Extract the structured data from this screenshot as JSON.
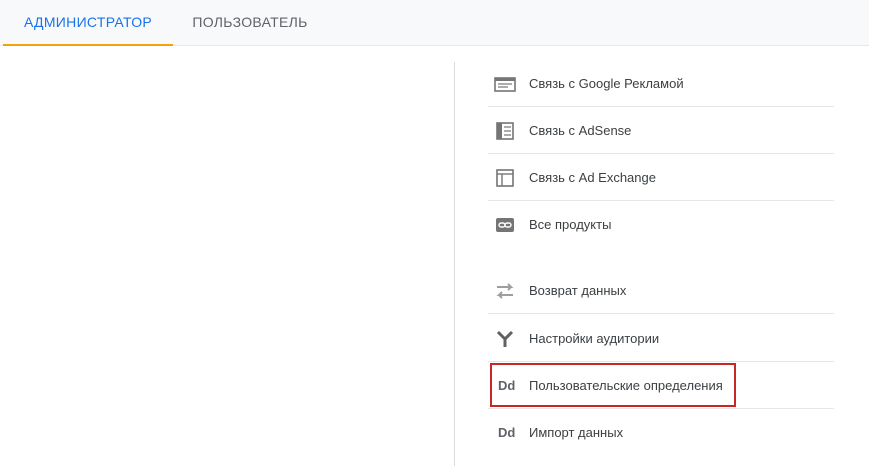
{
  "tabs": {
    "admin": "АДМИНИСТРАТОР",
    "user": "ПОЛЬЗОВАТЕЛЬ"
  },
  "menu": {
    "items": [
      {
        "label": "Связь с Google Рекламой",
        "icon": "ads-link-icon"
      },
      {
        "label": "Связь с AdSense",
        "icon": "adsense-link-icon"
      },
      {
        "label": "Связь с Ad Exchange",
        "icon": "ad-exchange-link-icon"
      },
      {
        "label": "Все продукты",
        "icon": "link-icon"
      },
      {
        "label": "Возврат данных",
        "icon": "data-return-icon"
      },
      {
        "label": "Настройки аудитории",
        "icon": "audience-fork-icon"
      },
      {
        "label": "Пользовательские определения",
        "icon": "dd-icon",
        "icon_text": "Dd",
        "highlighted": true
      },
      {
        "label": "Импорт данных",
        "icon": "dd-icon",
        "icon_text": "Dd"
      }
    ]
  },
  "colors": {
    "active_tab_text": "#1a73e8",
    "active_tab_underline": "#f4a20b",
    "highlight_border": "#c62828"
  }
}
